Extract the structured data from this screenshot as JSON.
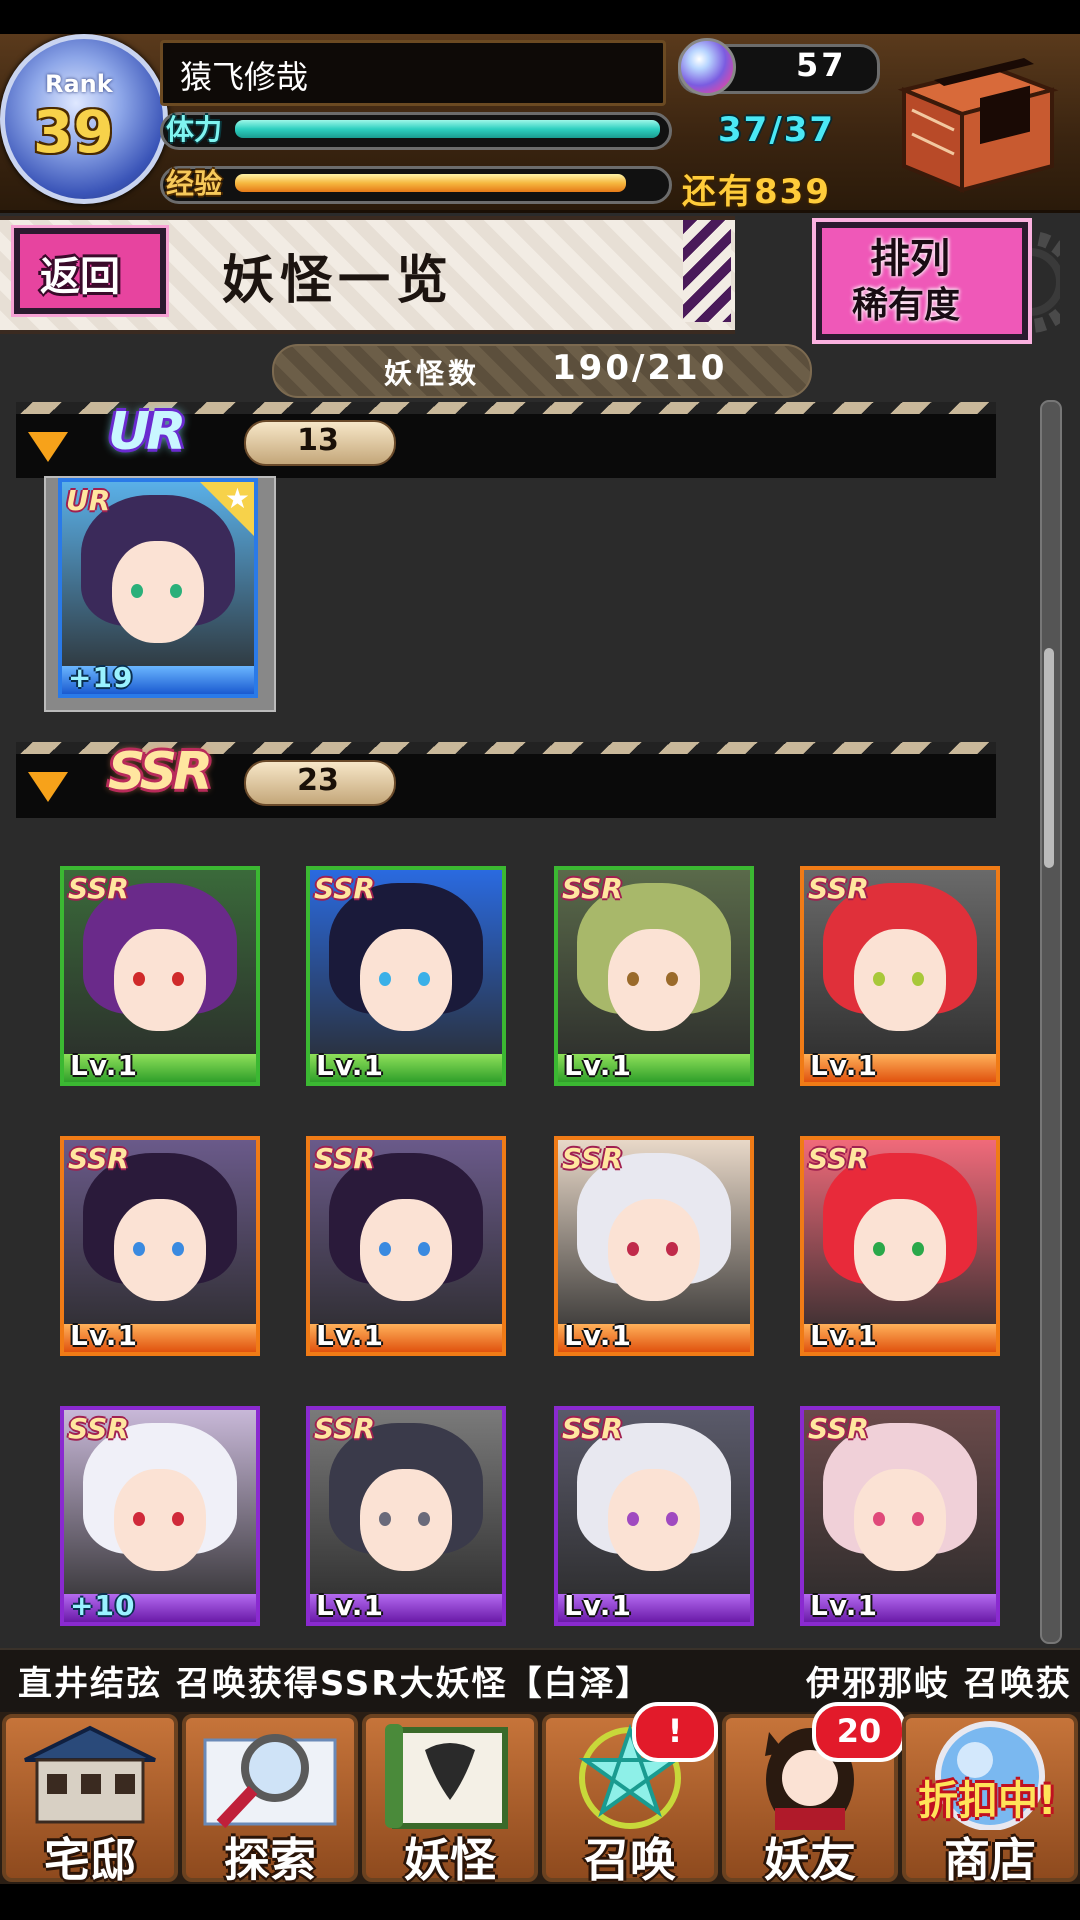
{
  "player": {
    "rank_label": "Rank",
    "rank": "39",
    "name": "猿飞修哉",
    "stamina_label": "体力",
    "stamina": "37/37",
    "stamina_fraction": 1.0,
    "exp_label": "经验",
    "exp_remaining": "还有839",
    "exp_fraction": 0.92,
    "orb_count": "57"
  },
  "header": {
    "back_label": "返回",
    "title": "妖怪一览",
    "sort_label_1": "排列",
    "sort_label_2": "稀有度"
  },
  "count": {
    "label": "妖怪数",
    "value": "190/210"
  },
  "sections": [
    {
      "rarity": "UR",
      "count": "13",
      "cards": [
        {
          "badge": "UR",
          "level": "+19",
          "frame": "blue",
          "hair": "#3b2a5a",
          "eye": "#2ab07a",
          "bg": "#5ab0e8"
        }
      ]
    },
    {
      "rarity": "SSR",
      "count": "23",
      "cards": [
        {
          "badge": "SSR",
          "level": "Lv.1",
          "frame": "green",
          "hair": "#6a2a8a",
          "eye": "#d02a2a",
          "bg": "#3a6a3a"
        },
        {
          "badge": "SSR",
          "level": "Lv.1",
          "frame": "green",
          "hair": "#1a1a3a",
          "eye": "#3ab0e8",
          "bg": "#2a6ae0"
        },
        {
          "badge": "SSR",
          "level": "Lv.1",
          "frame": "green",
          "hair": "#a8b86a",
          "eye": "#9a6a2a",
          "bg": "#5a6a4a"
        },
        {
          "badge": "SSR",
          "level": "Lv.1",
          "frame": "orange",
          "hair": "#e0303a",
          "eye": "#a8c83a",
          "bg": "#6a6a6a"
        },
        {
          "badge": "SSR",
          "level": "Lv.1",
          "frame": "orange",
          "hair": "#2a1a3a",
          "eye": "#3a8ae0",
          "bg": "#6a5a8a"
        },
        {
          "badge": "SSR",
          "level": "Lv.1",
          "frame": "orange",
          "hair": "#2a1a3a",
          "eye": "#3a8ae0",
          "bg": "#6a5a8a"
        },
        {
          "badge": "SSR",
          "level": "Lv.1",
          "frame": "orange",
          "hair": "#e8e8f0",
          "eye": "#c02a4a",
          "bg": "#e8d8c8"
        },
        {
          "badge": "SSR",
          "level": "Lv.1",
          "frame": "orange",
          "hair": "#e82a3a",
          "eye": "#2aa84a",
          "bg": "#f06a7a"
        },
        {
          "badge": "SSR",
          "level": "+10",
          "frame": "purple",
          "hair": "#f0f0f8",
          "eye": "#d02a3a",
          "bg": "#c8b8d8"
        },
        {
          "badge": "SSR",
          "level": "Lv.1",
          "frame": "purple",
          "hair": "#3a3a4a",
          "eye": "#6a6a7a",
          "bg": "#7a7a7a"
        },
        {
          "badge": "SSR",
          "level": "Lv.1",
          "frame": "purple",
          "hair": "#e8e8f0",
          "eye": "#a04ac0",
          "bg": "#5a5a6a"
        },
        {
          "badge": "SSR",
          "level": "Lv.1",
          "frame": "purple",
          "hair": "#f0d0d8",
          "eye": "#e04a7a",
          "bg": "#6a4a4a"
        }
      ]
    }
  ],
  "ticker": {
    "message_1": "直井结弦 召唤获得SSR大妖怪【白泽】",
    "message_2": "伊邪那岐 召唤获"
  },
  "nav": [
    {
      "label": "宅邸",
      "icon": "mansion-icon"
    },
    {
      "label": "探索",
      "icon": "magnifier-map-icon"
    },
    {
      "label": "妖怪",
      "icon": "scroll-icon"
    },
    {
      "label": "召唤",
      "icon": "pentagram-icon",
      "badge": "!"
    },
    {
      "label": "妖友",
      "icon": "friend-girl-icon",
      "badge": "20"
    },
    {
      "label": "商店",
      "icon": "orb-shop-icon",
      "sale": "折扣中!"
    }
  ],
  "colors": {
    "accent_pink": "#e7449f",
    "stamina": "#2ed0c0",
    "exp": "#f6b840"
  }
}
